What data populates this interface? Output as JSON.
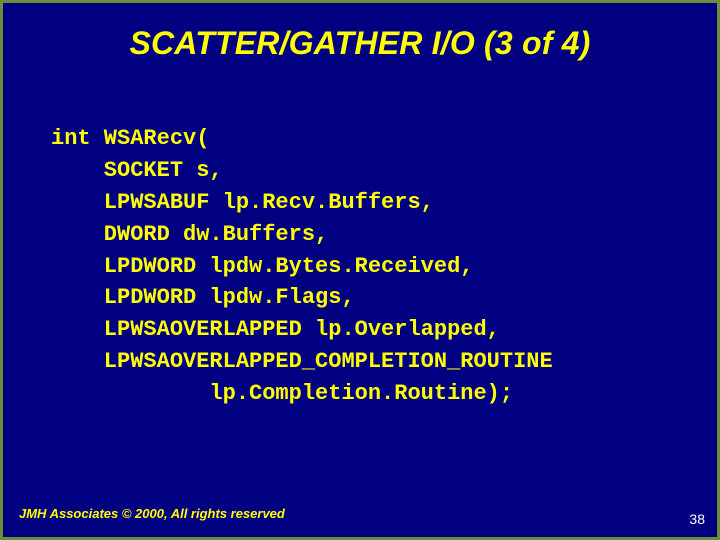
{
  "title": "SCATTER/GATHER I/O (3 of 4)",
  "code": {
    "l0": "int WSARecv(",
    "l1": "    SOCKET s,",
    "l2": "    LPWSABUF lp.Recv.Buffers,",
    "l3": "    DWORD dw.Buffers,",
    "l4": "    LPDWORD lpdw.Bytes.Received,",
    "l5": "    LPDWORD lpdw.Flags,",
    "l6": "    LPWSAOVERLAPPED lp.Overlapped,",
    "l7": "    LPWSAOVERLAPPED_COMPLETION_ROUTINE",
    "l8": "            lp.Completion.Routine);"
  },
  "footer": "JMH Associates © 2000, All rights reserved",
  "page": "38"
}
